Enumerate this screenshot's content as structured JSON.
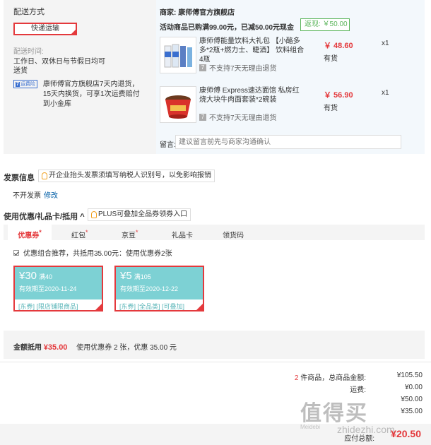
{
  "shipping": {
    "title": "配送方式",
    "method": "快递运输",
    "time_label": "配送时间:",
    "time_text_line1": "工作日、双休日与节假日均可",
    "time_text_line2": "送货",
    "insurance_badge_icon": "7",
    "insurance_badge": "运费险",
    "insurance_text": "康师傅官方旗舰店7天内退货，15天内换货，可享1次运费赔付到小金库"
  },
  "shop": {
    "seller_label": "商家:",
    "seller_name": "康师傅官方旗舰店",
    "promo": "活动商品已购满99.00元，已减50.00元现金",
    "cashback": "返现: ￥50.00",
    "products": [
      {
        "name": "康师傅能量饮料大礼包 【小酪多多*2瓶+燃力士、睫酒】 饮料组合4瓶",
        "price": "￥ 48.60",
        "stock": "有货",
        "qty": "x1",
        "no_return": "不支持7天无理由退货",
        "no_return_icon": "7"
      },
      {
        "name": "康师傅 Express速达面馆 私房红烧大块牛肉面套装*2碗装",
        "price": "￥ 56.90",
        "stock": "有货",
        "qty": "x1",
        "no_return": "不支持7天无理由退货",
        "no_return_icon": "7"
      }
    ],
    "message_label": "留言:",
    "message_placeholder": "建议留言前先与商家沟通确认"
  },
  "invoice": {
    "title": "发票信息",
    "tip": "开企业抬头发票须填写纳税人识别号，以免影响报销",
    "value": "不开发票",
    "edit": "修改"
  },
  "coupons": {
    "title": "使用优惠/礼品卡/抵用",
    "collapse_icon": "^",
    "plus_tip": "PLUS可叠加全品券领券入口",
    "tabs": [
      {
        "label": "优惠券",
        "star": "*"
      },
      {
        "label": "红包",
        "star": "*"
      },
      {
        "label": "京豆",
        "star": "*"
      },
      {
        "label": "礼品卡",
        "star": ""
      },
      {
        "label": "领货码",
        "star": ""
      }
    ],
    "combo": "优惠组合推荐，共抵用35.00元：使用优惠券2张",
    "items": [
      {
        "amount": "¥30",
        "cond": "满40",
        "expire": "有效期至2020-11-24",
        "tags": "[东券] [限店铺限商品]"
      },
      {
        "amount": "¥5",
        "cond": "满105",
        "expire": "有效期至2020-12-22",
        "tags": "[东券] [全品类] [可叠加]"
      }
    ],
    "summary_label": "金额抵用",
    "summary_amount": "¥35.00",
    "summary_desc": "使用优惠券 2 张，优惠 35.00 元"
  },
  "totals": {
    "count": "2",
    "count_suffix": " 件商品，总商品金额:",
    "goods_amount": "¥105.50",
    "freight_label": "运费:",
    "freight": "¥0.00",
    "row3_value": "¥50.00",
    "row4_value": "¥35.00",
    "payable_label": "应付总额:",
    "payable": "¥20.50"
  },
  "watermark": {
    "big": "值得买",
    "small": "zhidezhi.com",
    "tiny": "Meidebi"
  }
}
